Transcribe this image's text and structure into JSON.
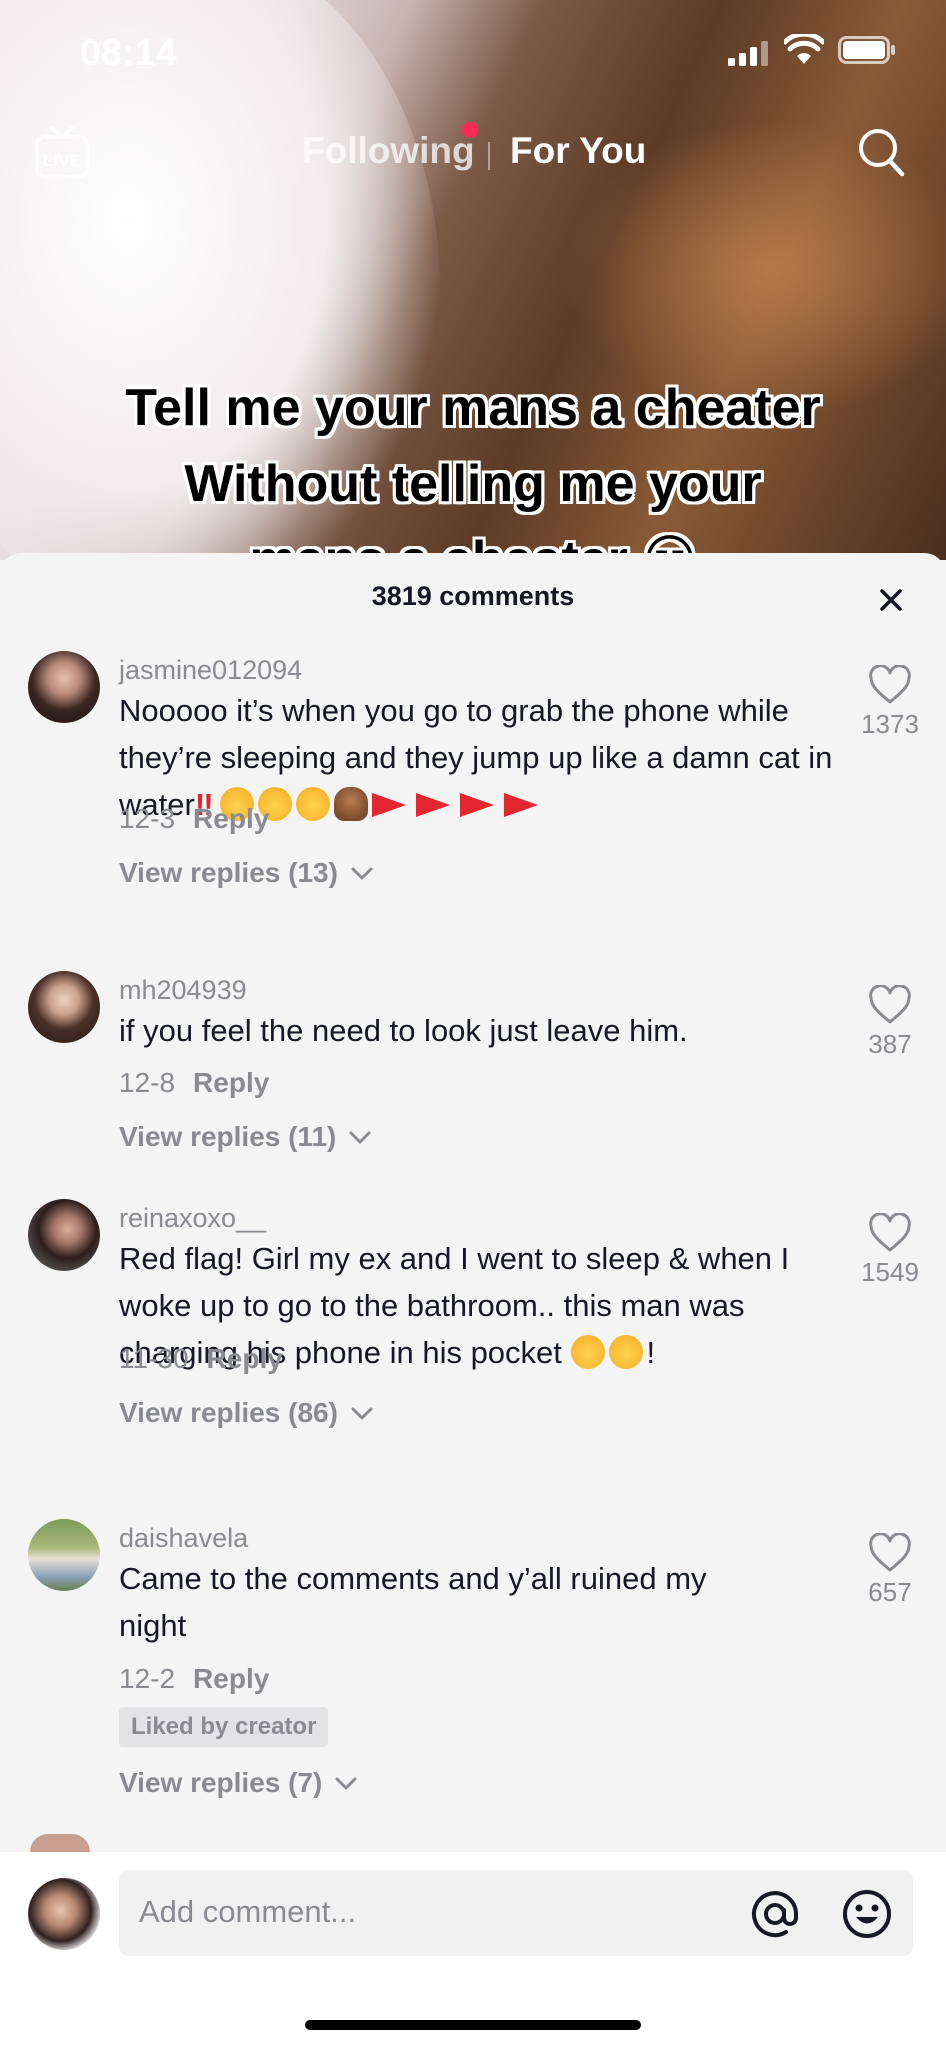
{
  "status_bar": {
    "time": "08:14"
  },
  "top_nav": {
    "live_label": "LIVE",
    "tabs": [
      {
        "label": "Following"
      },
      {
        "label": "For You"
      }
    ],
    "active_tab": "For You"
  },
  "video": {
    "caption_lines": [
      "Tell me your mans a cheater",
      "Without telling me your",
      "mans a cheater 😏"
    ]
  },
  "comments_sheet": {
    "title": "3819 comments",
    "comments": [
      {
        "username": "jasmine012094",
        "text": "Nooooo it’s when you go to grab the phone while they’re sleeping and they jump up like a damn cat in water",
        "emoji_tail": [
          "double-exclamation",
          "flushed-face",
          "smirk-face",
          "tears-of-joy",
          "facepalm-person",
          "red-flag",
          "red-flag",
          "red-flag",
          "red-flag"
        ],
        "date": "12-3",
        "reply_label": "Reply",
        "view_replies": "View replies (13)",
        "likes": "1373"
      },
      {
        "username": "mh204939",
        "text": "if you feel the need to look just leave him.",
        "date": "12-8",
        "reply_label": "Reply",
        "view_replies": "View replies (11)",
        "likes": "387"
      },
      {
        "username": "reinaxoxo__",
        "text": "Red flag! Girl my ex and I went to sleep & when I woke up to go to the bathroom.. this man was charging his phone in his pocket",
        "emoji_tail": [
          "tears-of-joy",
          "tears-of-joy"
        ],
        "text_end": "!",
        "date": "11-30",
        "reply_label": "Reply",
        "view_replies": "View replies (86)",
        "likes": "1549"
      },
      {
        "username": "daishavela",
        "text": "Came to the comments and y’all ruined my night",
        "date": "12-2",
        "reply_label": "Reply",
        "badge": "Liked by creator",
        "view_replies": "View replies (7)",
        "likes": "657"
      }
    ]
  },
  "composer": {
    "placeholder": "Add comment..."
  },
  "colors": {
    "accent_dot": "#fe2c55",
    "sheet_bg": "#f4f4f4",
    "secondary_text": "#8a8b91",
    "primary_text": "#161823",
    "red_flag": "#e3262f"
  }
}
